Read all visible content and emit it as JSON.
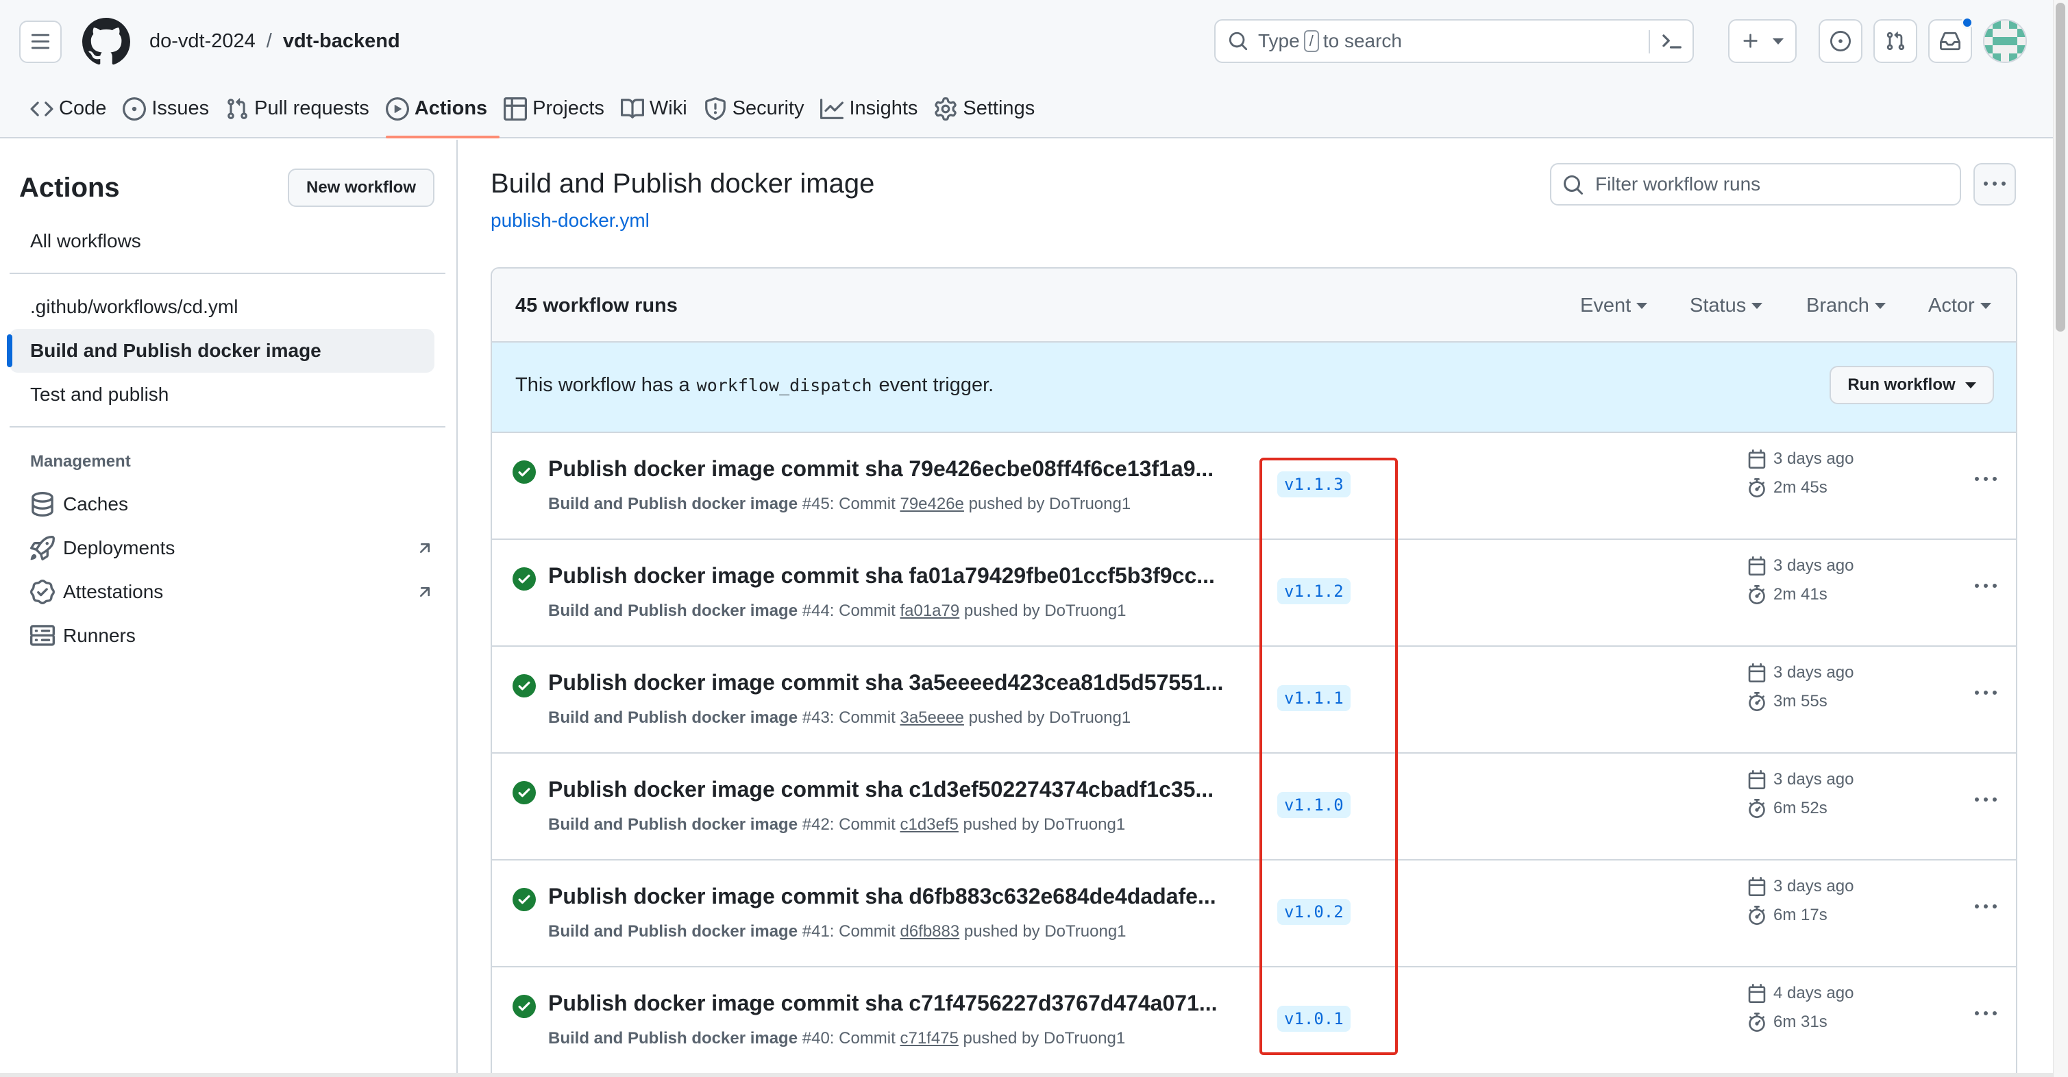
{
  "header": {
    "owner": "do-vdt-2024",
    "separator": "/",
    "repo": "vdt-backend",
    "search": {
      "prefix": "Type",
      "key": "/",
      "suffix": "to search"
    }
  },
  "repo_nav": [
    {
      "label": "Code",
      "icon": "code-icon"
    },
    {
      "label": "Issues",
      "icon": "issue-icon"
    },
    {
      "label": "Pull requests",
      "icon": "pull-request-icon"
    },
    {
      "label": "Actions",
      "icon": "play-icon",
      "active": true
    },
    {
      "label": "Projects",
      "icon": "table-icon"
    },
    {
      "label": "Wiki",
      "icon": "book-icon"
    },
    {
      "label": "Security",
      "icon": "shield-icon"
    },
    {
      "label": "Insights",
      "icon": "graph-icon"
    },
    {
      "label": "Settings",
      "icon": "gear-icon"
    }
  ],
  "sidebar": {
    "title": "Actions",
    "new_workflow": "New workflow",
    "all_workflows": "All workflows",
    "workflows": [
      {
        "label": ".github/workflows/cd.yml"
      },
      {
        "label": "Build and Publish docker image",
        "selected": true
      },
      {
        "label": "Test and publish"
      }
    ],
    "management_heading": "Management",
    "management": [
      {
        "label": "Caches",
        "icon": "database-icon"
      },
      {
        "label": "Deployments",
        "icon": "rocket-icon",
        "external": true
      },
      {
        "label": "Attestations",
        "icon": "verified-icon",
        "external": true
      },
      {
        "label": "Runners",
        "icon": "server-icon"
      }
    ]
  },
  "main": {
    "title": "Build and Publish docker image",
    "file": "publish-docker.yml",
    "filter_placeholder": "Filter workflow runs",
    "runs_count": "45 workflow runs",
    "filters": [
      "Event",
      "Status",
      "Branch",
      "Actor"
    ],
    "dispatch_prefix": "This workflow has a",
    "dispatch_code": "workflow_dispatch",
    "dispatch_suffix": "event trigger.",
    "run_workflow": "Run workflow",
    "runs": [
      {
        "title": "Publish docker image commit sha 79e426ecbe08ff4f6ce13f1a9...",
        "workflow": "Build and Publish docker image",
        "number": "#45",
        "commit_label": ": Commit",
        "sha": "79e426e",
        "pushed_by": "pushed by",
        "actor": "DoTruong1",
        "branch": "v1.1.3",
        "when": "3 days ago",
        "duration": "2m 45s",
        "status": "success"
      },
      {
        "title": "Publish docker image commit sha fa01a79429fbe01ccf5b3f9cc...",
        "workflow": "Build and Publish docker image",
        "number": "#44",
        "commit_label": ": Commit",
        "sha": "fa01a79",
        "pushed_by": "pushed by",
        "actor": "DoTruong1",
        "branch": "v1.1.2",
        "when": "3 days ago",
        "duration": "2m 41s",
        "status": "success"
      },
      {
        "title": "Publish docker image commit sha 3a5eeeed423cea81d5d57551...",
        "workflow": "Build and Publish docker image",
        "number": "#43",
        "commit_label": ": Commit",
        "sha": "3a5eeee",
        "pushed_by": "pushed by",
        "actor": "DoTruong1",
        "branch": "v1.1.1",
        "when": "3 days ago",
        "duration": "3m 55s",
        "status": "success"
      },
      {
        "title": "Publish docker image commit sha c1d3ef502274374cbadf1c35...",
        "workflow": "Build and Publish docker image",
        "number": "#42",
        "commit_label": ": Commit",
        "sha": "c1d3ef5",
        "pushed_by": "pushed by",
        "actor": "DoTruong1",
        "branch": "v1.1.0",
        "when": "3 days ago",
        "duration": "6m 52s",
        "status": "success"
      },
      {
        "title": "Publish docker image commit sha d6fb883c632e684de4dadafe...",
        "workflow": "Build and Publish docker image",
        "number": "#41",
        "commit_label": ": Commit",
        "sha": "d6fb883",
        "pushed_by": "pushed by",
        "actor": "DoTruong1",
        "branch": "v1.0.2",
        "when": "3 days ago",
        "duration": "6m 17s",
        "status": "success"
      },
      {
        "title": "Publish docker image commit sha c71f4756227d3767d474a071...",
        "workflow": "Build and Publish docker image",
        "number": "#40",
        "commit_label": ": Commit",
        "sha": "c71f475",
        "pushed_by": "pushed by",
        "actor": "DoTruong1",
        "branch": "v1.0.1",
        "when": "4 days ago",
        "duration": "6m 31s",
        "status": "success"
      }
    ]
  },
  "colors": {
    "accent": "#0969da",
    "success": "#1a7f37",
    "active_tab_underline": "#fd8c73",
    "annotation_box": "#e02c1f",
    "dispatch_bg": "#ddf4ff"
  }
}
